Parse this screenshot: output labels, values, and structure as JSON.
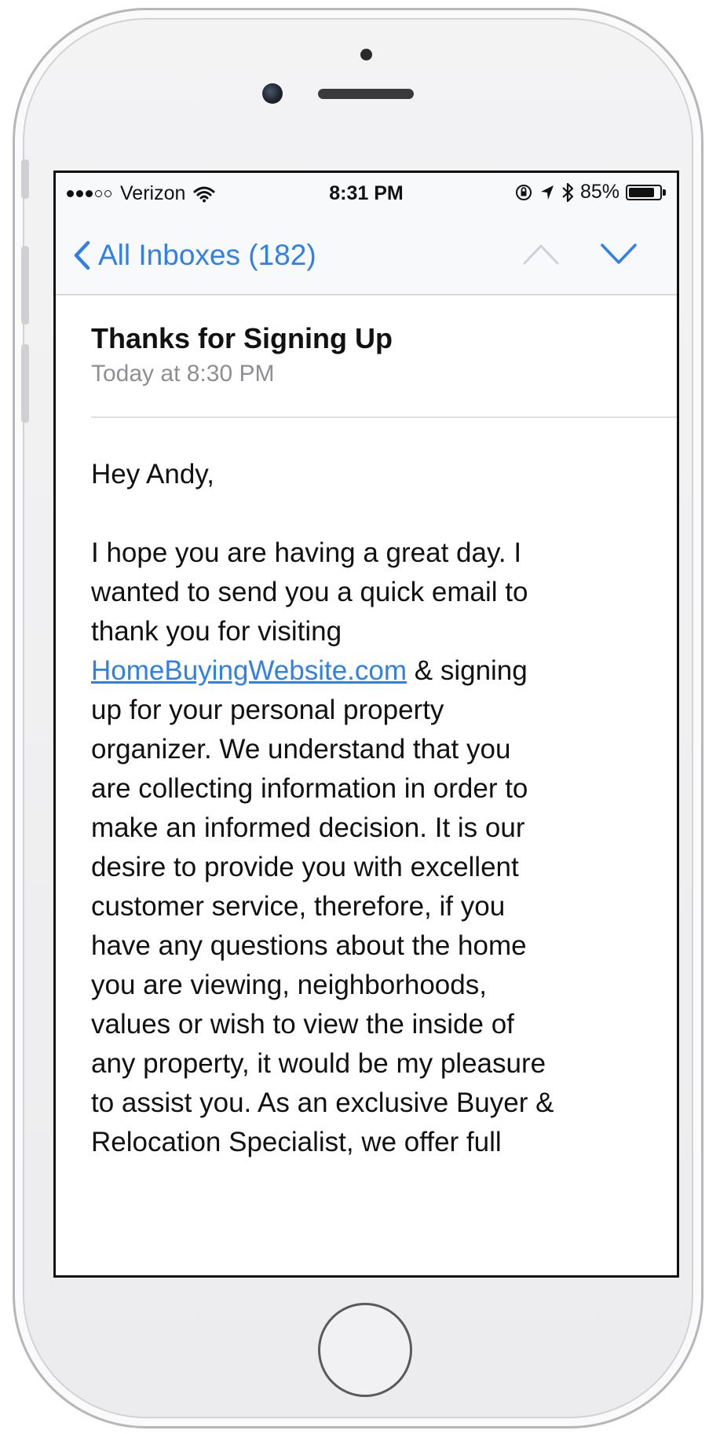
{
  "status_bar": {
    "carrier": "Verizon",
    "time": "8:31 PM",
    "battery_percent": "85%",
    "battery_level": 0.85,
    "signal_dots_on": 3,
    "signal_dots_total": 5
  },
  "nav": {
    "back_label": "All Inboxes (182)",
    "accent_color": "#2f80e8"
  },
  "message": {
    "subject": "Thanks for Signing Up",
    "date": "Today at 8:30 PM",
    "greeting": "Hey Andy,",
    "body_lines": [
      "I hope you are having a great day. I",
      "wanted to send you a quick email to",
      "thank you for visiting",
      "",
      "up for your personal property",
      "organizer. We understand that you",
      "are collecting information in order to",
      "make an informed decision. It is our",
      "desire to provide you with excellent",
      "customer service, therefore, if you",
      "have any questions about the home",
      "you are viewing, neighborhoods,",
      "values or wish to view the inside of",
      "any property, it would be my pleasure",
      "to assist you. As an exclusive Buyer &",
      "Relocation Specialist, we offer full"
    ],
    "link_text": "HomeBuyingWebsite.com",
    "link_suffix": " & signing"
  }
}
